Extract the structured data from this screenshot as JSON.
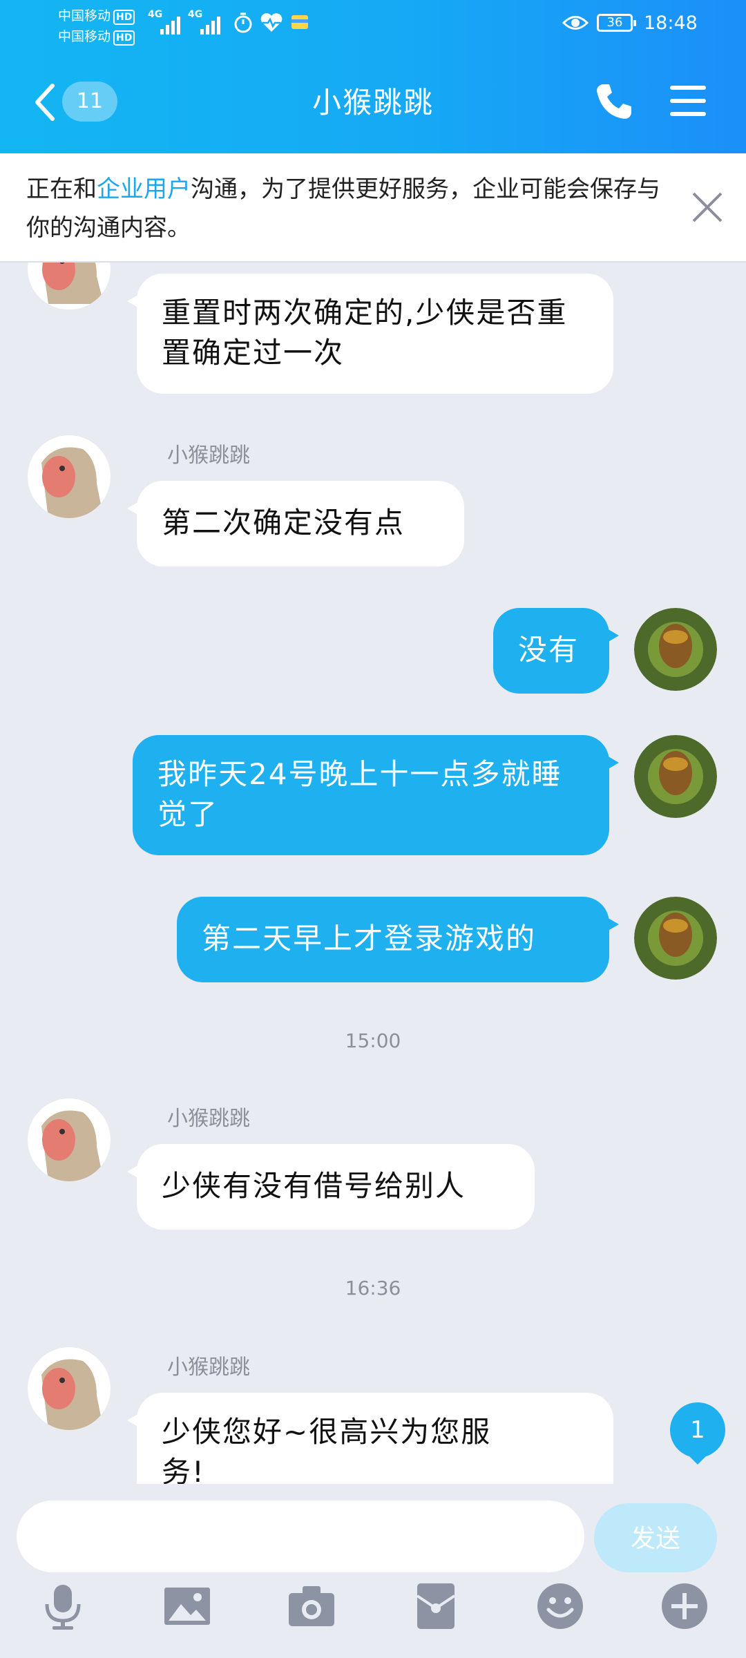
{
  "status_bar": {
    "carrier1": "中国移动",
    "carrier2": "中国移动",
    "hd": "HD",
    "net1": "4G",
    "net2": "4G",
    "battery": "36",
    "time": "18:48"
  },
  "header": {
    "unread_count": "11",
    "title": "小猴跳跳"
  },
  "notice": {
    "prefix": "正在和",
    "highlight": "企业用户",
    "suffix": "沟通，为了提供更好服务，企业可能会保存与你的沟通内容。"
  },
  "messages": [
    {
      "side": "in",
      "text": "重置时两次确定的,少侠是否重置确定过一次"
    },
    {
      "side": "in",
      "sender": "小猴跳跳",
      "text": "第二次确定没有点"
    },
    {
      "side": "out",
      "text": "没有"
    },
    {
      "side": "out",
      "text": "我昨天24号晚上十一点多就睡觉了"
    },
    {
      "side": "out",
      "text": "第二天早上才登录游戏的"
    },
    {
      "type": "time",
      "text": "15:00"
    },
    {
      "side": "in",
      "sender": "小猴跳跳",
      "text": "少侠有没有借号给别人"
    },
    {
      "type": "time",
      "text": "16:36"
    },
    {
      "side": "in",
      "sender": "小猴跳跳",
      "text": "少侠您好~很高兴为您服务!"
    }
  ],
  "new_message_badge": "1",
  "input": {
    "placeholder": "",
    "send_label": "发送"
  },
  "toolbar": [
    "microphone-icon",
    "image-icon",
    "camera-icon",
    "red-packet-icon",
    "emoji-icon",
    "plus-icon"
  ],
  "colors": {
    "header": "#16a9f5",
    "out_bubble": "#1fb0f0",
    "in_bubble": "#ffffff",
    "background": "#e9ebf3"
  }
}
